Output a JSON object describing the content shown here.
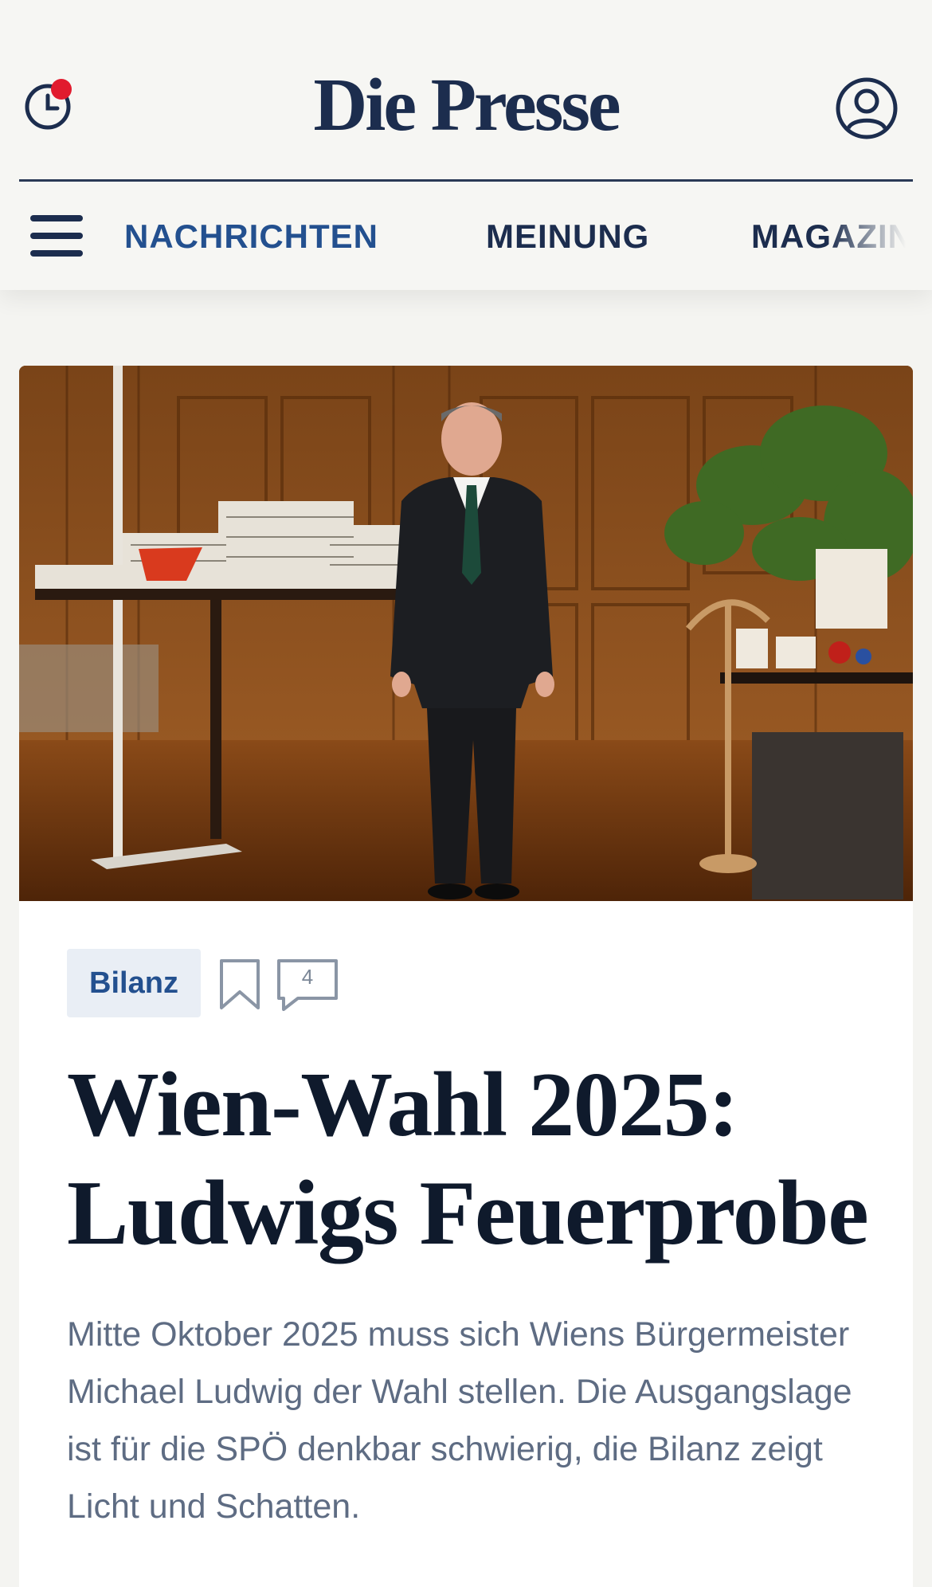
{
  "header": {
    "logo": "Die Presse",
    "history_label": "",
    "account_label": ""
  },
  "nav": {
    "items": [
      {
        "label": "NACHRICHTEN",
        "active": true
      },
      {
        "label": "MEINUNG",
        "active": false
      },
      {
        "label": "MAGAZIN",
        "active": false
      }
    ]
  },
  "article": {
    "tag": "Bilanz",
    "comment_count": "4",
    "title": "Wien-Wahl 2025: Ludwigs Feuerprobe",
    "lead": "Mitte Oktober 2025 muss sich Wiens Bürgermeister Michael Ludwig der Wahl stellen. Die Ausgangslage ist für die SPÖ denkbar schwierig, die Bilanz zeigt Licht und Schatten."
  },
  "colors": {
    "brand_navy": "#1c2d4e",
    "nav_active": "#23508f",
    "notification_dot": "#e11b2e",
    "tag_background": "#e9eef5",
    "lead_text": "#5e6c83"
  },
  "icons": [
    "clock-icon",
    "notification-dot",
    "user-icon",
    "menu-icon",
    "bookmark-icon",
    "comment-icon"
  ]
}
